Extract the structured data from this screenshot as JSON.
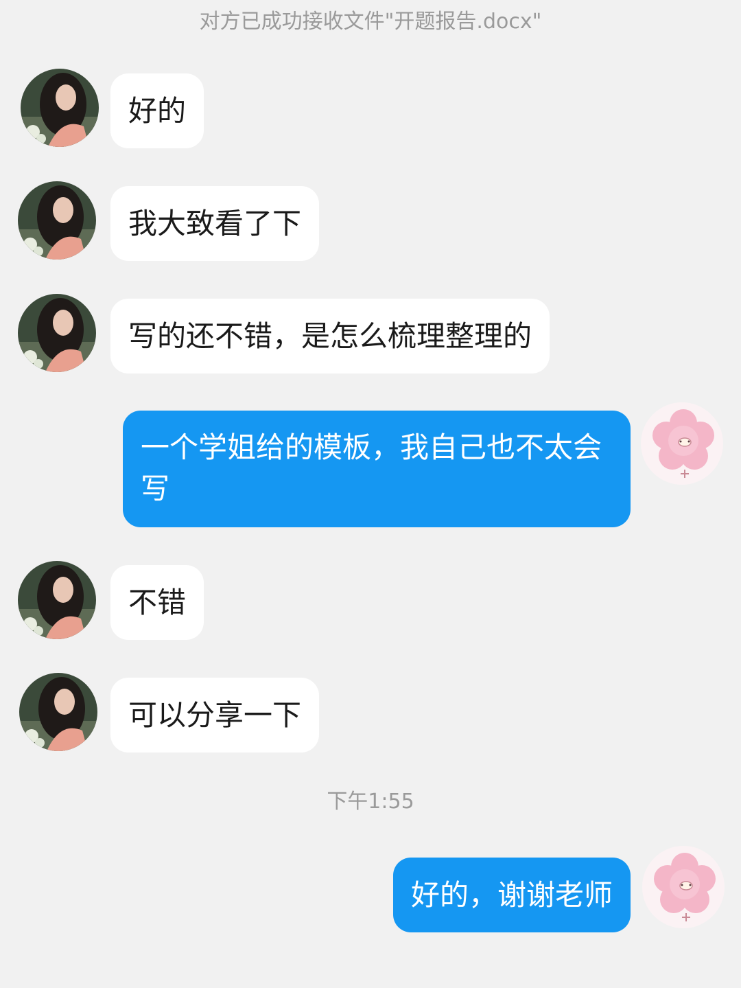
{
  "chat": {
    "system_notice": "对方已成功接收文件\"开题报告.docx\"",
    "timestamp": "下午1:55",
    "messages": [
      {
        "from": "teacher",
        "text": "好的"
      },
      {
        "from": "teacher",
        "text": "我大致看了下"
      },
      {
        "from": "teacher",
        "text": "写的还不错，是怎么梳理整理的"
      },
      {
        "from": "me",
        "text": "一个学姐给的模板，我自己也不太会写"
      },
      {
        "from": "teacher",
        "text": "不错"
      },
      {
        "from": "teacher",
        "text": "可以分享一下"
      },
      {
        "from": "me",
        "text": "好的，谢谢老师"
      }
    ]
  },
  "icons": {
    "teacher_avatar": "photo-avatar-icon",
    "my_avatar": "pink-flower-avatar-icon"
  },
  "colors": {
    "background": "#f1f1f1",
    "incoming_bubble": "#ffffff",
    "outgoing_bubble": "#1597f2",
    "meta_text": "#9a9a9a"
  }
}
